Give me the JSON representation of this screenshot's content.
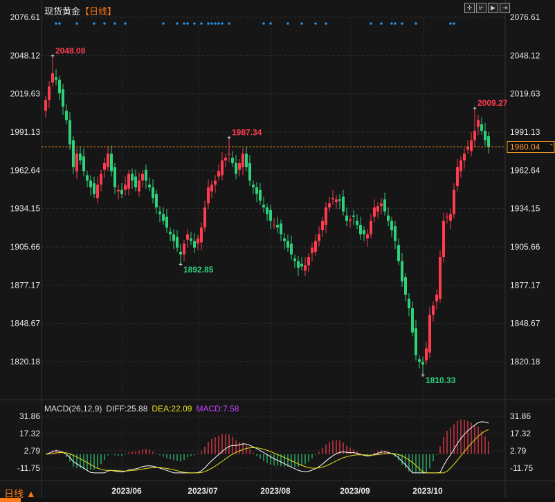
{
  "header": {
    "title": "现货黄金",
    "timeframe": "【日线】"
  },
  "toolbar": {
    "icons": [
      "crosshair-icon",
      "zoom-in-icon",
      "play-icon",
      "jump-to-end-icon"
    ]
  },
  "colors": {
    "up": "#ff3b4f",
    "down": "#2fd07a",
    "diff": "#ffffff",
    "dea": "#e8e21a",
    "macd_label": "#c040ff",
    "last_price": "#ff9a2a",
    "marker": "#2a8fe0"
  },
  "price_axis": {
    "labels": [
      "2076.61",
      "2048.12",
      "2019.63",
      "1991.13",
      "1962.64",
      "1934.15",
      "1905.66",
      "1877.17",
      "1848.67",
      "1820.18"
    ]
  },
  "last_price": "1980.04",
  "annotations": [
    {
      "index": 2,
      "text": "2048.08",
      "type": "high"
    },
    {
      "index": 39,
      "text": "1892.85",
      "type": "low"
    },
    {
      "index": 53,
      "text": "1987.34",
      "type": "high"
    },
    {
      "index": 109,
      "text": "1810.33",
      "type": "low"
    },
    {
      "index": 124,
      "text": "2009.27",
      "type": "high"
    }
  ],
  "macd": {
    "legend": "MACD(26,12,9)",
    "diff": "DIFF:25.88",
    "dea": "DEA:22.09",
    "macd": "MACD:7.58",
    "axis": [
      "31.86",
      "17.32",
      "2.79",
      "-11.75"
    ]
  },
  "x_axis": {
    "labels": [
      {
        "index": 23,
        "text": "2023/06"
      },
      {
        "index": 45,
        "text": "2023/07"
      },
      {
        "index": 66,
        "text": "2023/08"
      },
      {
        "index": 89,
        "text": "2023/09"
      },
      {
        "index": 110,
        "text": "2023/10"
      }
    ]
  },
  "footer": {
    "period": "日线 ▲"
  },
  "chart_data": {
    "type": "candlestick",
    "ylim": [
      1810.33,
      2076.61
    ],
    "markers": [
      3,
      4,
      9,
      14,
      17,
      20,
      23,
      34,
      38,
      40,
      41,
      43,
      45,
      47,
      48,
      49,
      50,
      51,
      53,
      63,
      65,
      70,
      74,
      78,
      81,
      94,
      97,
      100,
      101,
      103,
      107,
      117,
      118
    ],
    "close": [
      2015,
      2025,
      2035,
      2030,
      2020,
      2010,
      2000,
      1982,
      1965,
      1975,
      1970,
      1962,
      1955,
      1950,
      1945,
      1952,
      1960,
      1968,
      1975,
      1962,
      1950,
      1948,
      1945,
      1952,
      1960,
      1955,
      1950,
      1955,
      1960,
      1955,
      1950,
      1942,
      1935,
      1930,
      1925,
      1920,
      1915,
      1910,
      1905,
      1900,
      1908,
      1915,
      1910,
      1905,
      1912,
      1920,
      1935,
      1950,
      1952,
      1955,
      1962,
      1970,
      1972,
      1975,
      1968,
      1960,
      1968,
      1975,
      1965,
      1955,
      1950,
      1945,
      1940,
      1935,
      1930,
      1925,
      1922,
      1920,
      1915,
      1910,
      1905,
      1900,
      1895,
      1890,
      1891,
      1892,
      1898,
      1905,
      1910,
      1915,
      1925,
      1935,
      1938,
      1942,
      1941,
      1940,
      1932,
      1925,
      1926,
      1928,
      1922,
      1915,
      1915,
      1915,
      1925,
      1935,
      1936,
      1938,
      1932,
      1925,
      1918,
      1910,
      1895,
      1880,
      1870,
      1860,
      1842,
      1825,
      1820,
      1818,
      1830,
      1855,
      1862,
      1870,
      1898,
      1925,
      1928,
      1930,
      1948,
      1965,
      1970,
      1975,
      1980,
      1985,
      1992,
      2000,
      1992,
      1985,
      1980.04
    ]
  }
}
